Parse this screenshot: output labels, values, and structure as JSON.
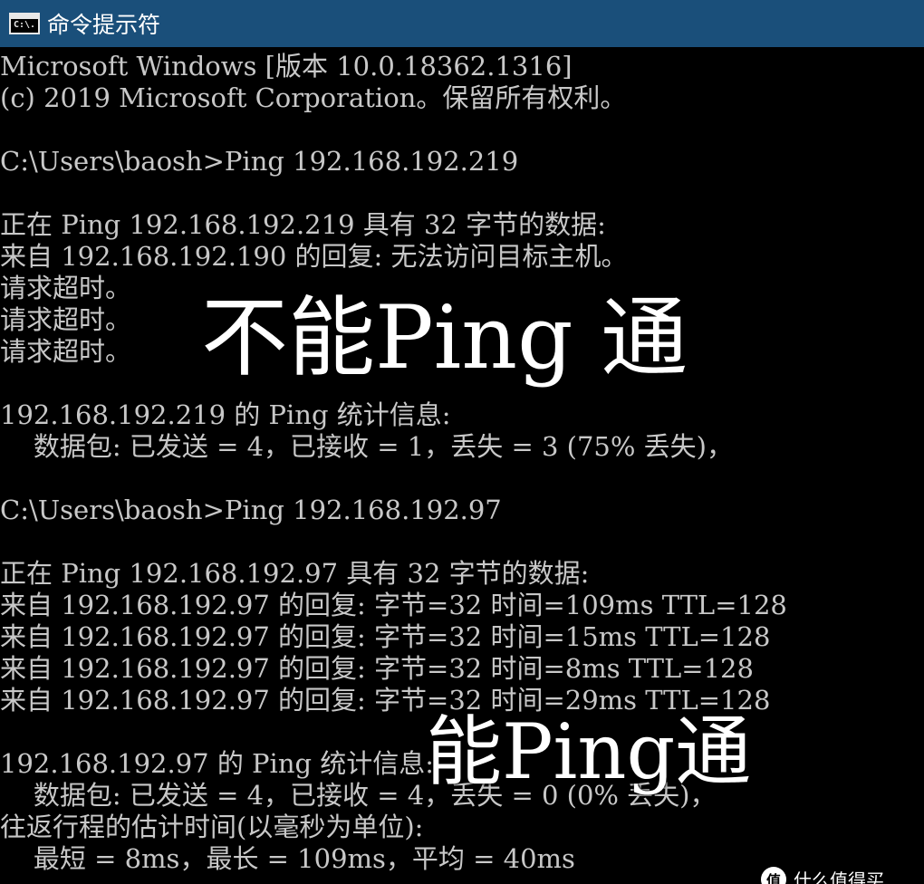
{
  "window": {
    "title": "命令提示符",
    "icon": "cmd-icon",
    "icon_label": "C:\\.",
    "title_bar_color": "#1a4f7a",
    "background_color": "#000000",
    "text_color": "#c8c8c8"
  },
  "console": {
    "lines": [
      "Microsoft Windows [版本 10.0.18362.1316]",
      "(c) 2019 Microsoft Corporation。保留所有权利。",
      "",
      "C:\\Users\\baosh>Ping 192.168.192.219",
      "",
      "正在 Ping 192.168.192.219 具有 32 字节的数据:",
      "来自 192.168.192.190 的回复: 无法访问目标主机。",
      "请求超时。",
      "请求超时。",
      "请求超时。",
      "",
      "192.168.192.219 的 Ping 统计信息:",
      "    数据包: 已发送 = 4，已接收 = 1，丢失 = 3 (75% 丢失)，",
      "",
      "C:\\Users\\baosh>Ping 192.168.192.97",
      "",
      "正在 Ping 192.168.192.97 具有 32 字节的数据:",
      "来自 192.168.192.97 的回复: 字节=32 时间=109ms TTL=128",
      "来自 192.168.192.97 的回复: 字节=32 时间=15ms TTL=128",
      "来自 192.168.192.97 的回复: 字节=32 时间=8ms TTL=128",
      "来自 192.168.192.97 的回复: 字节=32 时间=29ms TTL=128",
      "",
      "192.168.192.97 的 Ping 统计信息:",
      "    数据包: 已发送 = 4，已接收 = 4，丢失 = 0 (0% 丢失)，",
      "往返行程的估计时间(以毫秒为单位):",
      "    最短 = 8ms，最长 = 109ms，平均 = 40ms"
    ]
  },
  "annotations": {
    "fail": "不能Ping 通",
    "success": "能Ping通",
    "color": "#ffffff"
  },
  "watermark": {
    "badge": "值",
    "text": "什么值得买"
  }
}
